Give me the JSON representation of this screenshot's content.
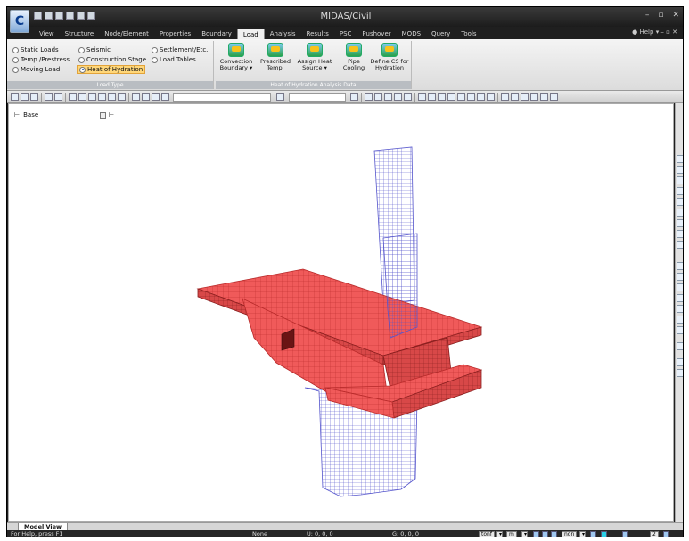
{
  "app": {
    "title": "MIDAS/Civil",
    "logo_letter": "C"
  },
  "menu": {
    "tabs": [
      "View",
      "Structure",
      "Node/Element",
      "Properties",
      "Boundary",
      "Load",
      "Analysis",
      "Results",
      "PSC",
      "Pushover",
      "MODS",
      "Query",
      "Tools"
    ],
    "active_tab": "Load",
    "help_label": "Help"
  },
  "ribbon": {
    "load_type": {
      "caption": "Load Type",
      "items": [
        {
          "label": "Static Loads",
          "selected": false
        },
        {
          "label": "Temp./Prestress",
          "selected": false
        },
        {
          "label": "Moving Load",
          "selected": false
        },
        {
          "label": "Seismic",
          "selected": false
        },
        {
          "label": "Construction Stage",
          "selected": false
        },
        {
          "label": "Heat of Hydration",
          "selected": true
        },
        {
          "label": "Settlement/Etc.",
          "selected": false
        },
        {
          "label": "Load Tables",
          "selected": false
        }
      ]
    },
    "hydration": {
      "caption": "Heat of Hydration Analysis Data",
      "buttons": [
        {
          "line1": "Convection",
          "line2": "Boundary ▾"
        },
        {
          "line1": "Prescribed",
          "line2": "Temp."
        },
        {
          "line1": "Assign Heat",
          "line2": "Source ▾"
        },
        {
          "line1": "Pipe",
          "line2": "Cooling"
        },
        {
          "line1": "Define CS for",
          "line2": "Hydration"
        }
      ]
    }
  },
  "model_view": {
    "base_label": "Base",
    "tab_label": "Model View"
  },
  "status": {
    "help_text": "For Help, press F1",
    "selection": "None",
    "u_coords": "U: 0, 0, 0",
    "g_coords": "G: 0, 0, 0",
    "force_unit": "tonf",
    "length_unit": "m",
    "option": "non",
    "page": "2"
  },
  "colors": {
    "solid_fill": "#f05a5a",
    "solid_edge": "#b82a2a",
    "pipe_mesh": "#5555cc",
    "title_bg": "#1e1e1e"
  }
}
